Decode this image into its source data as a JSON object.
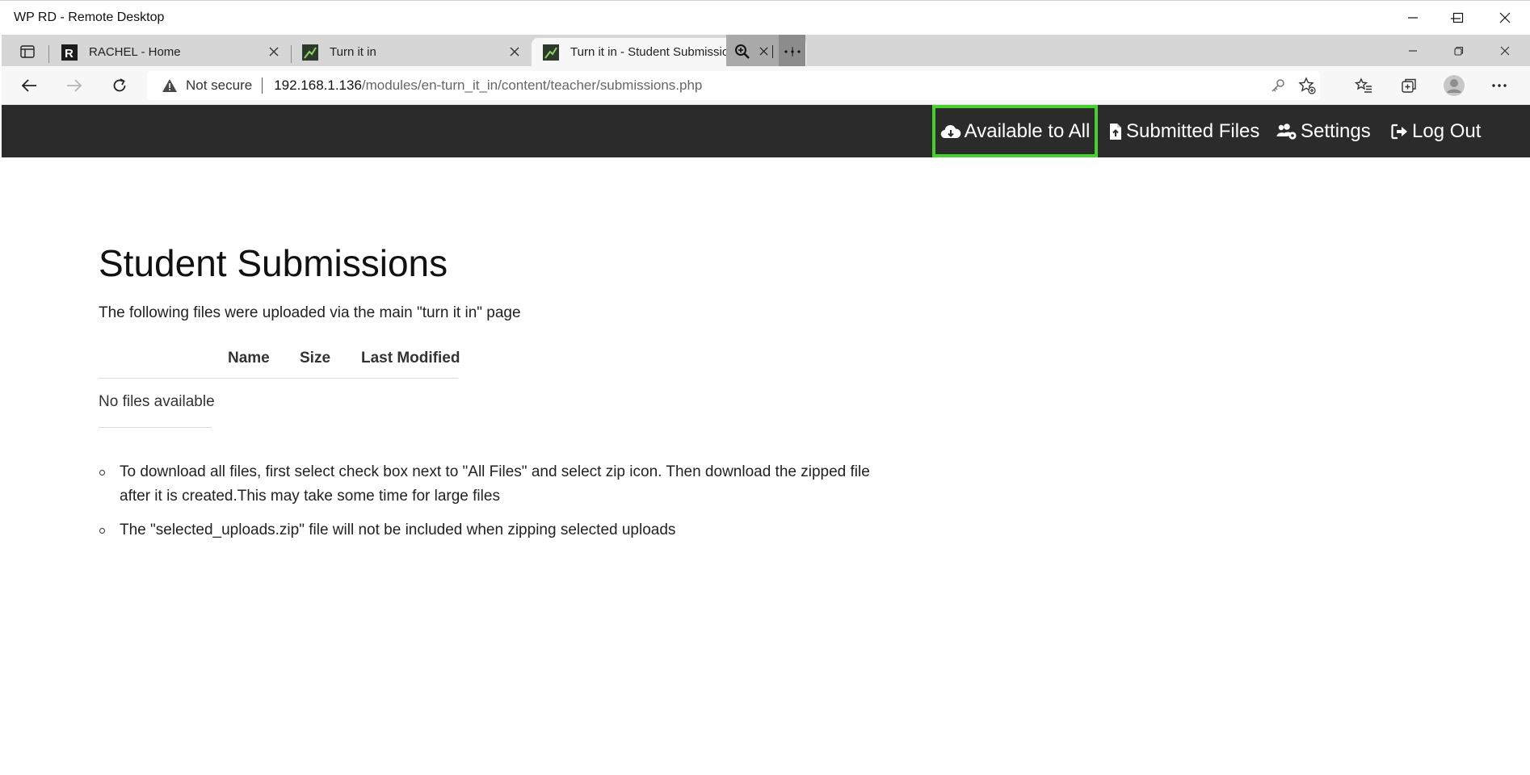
{
  "window": {
    "title": "WP RD - Remote Desktop"
  },
  "tabs": [
    {
      "title": "RACHEL - Home",
      "icon": "rachel-logo-icon"
    },
    {
      "title": "Turn it in",
      "icon": "turn-it-in-favicon-icon"
    },
    {
      "title": "Turn it in - Student Submissions",
      "icon": "turn-it-in-favicon-icon",
      "active": true
    }
  ],
  "address_bar": {
    "security_label": "Not secure",
    "url_host": "192.168.1.136",
    "url_path": "/modules/en-turn_it_in/content/teacher/submissions.php"
  },
  "site_nav": {
    "items": [
      {
        "label": "Available to All",
        "icon": "cloud-download-icon",
        "highlighted": true
      },
      {
        "label": "Submitted Files",
        "icon": "file-upload-icon"
      },
      {
        "label": "Settings",
        "icon": "users-gear-icon"
      },
      {
        "label": "Log Out",
        "icon": "sign-out-icon"
      }
    ]
  },
  "main": {
    "title": "Student Submissions",
    "intro": "The following files were uploaded via the main \"turn it in\" page",
    "table": {
      "columns": [
        "Name",
        "Size",
        "Last Modified"
      ],
      "empty_message": "No files available"
    },
    "notes": [
      "To download all files, first select check box next to \"All Files\" and select zip icon. Then download the zipped file after it is created.This may take some time for large files",
      "The \"selected_uploads.zip\" file will not be included when zipping selected uploads"
    ]
  },
  "colors": {
    "nav_background": "#2b2b2b",
    "highlight_border": "#45d22f",
    "tab_strip": "#d6d6d6",
    "toolbar": "#f7f7f7"
  }
}
